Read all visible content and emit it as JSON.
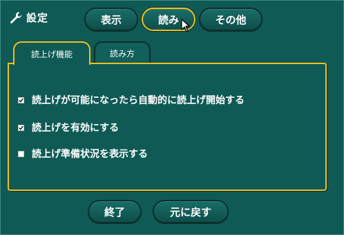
{
  "header": {
    "title": "設定"
  },
  "tabs": [
    {
      "label": "表示",
      "active": false
    },
    {
      "label": "読み",
      "active": true
    },
    {
      "label": "その他",
      "active": false
    }
  ],
  "subtabs": [
    {
      "label": "読上げ機能",
      "active": true
    },
    {
      "label": "読み方",
      "active": false
    }
  ],
  "options": [
    {
      "label": "読上げが可能になったら自動的に読上げ開始する",
      "checked": true
    },
    {
      "label": "読上げを有効にする",
      "checked": true
    },
    {
      "label": "読上げ準備状況を表示する",
      "checked": false
    }
  ],
  "footer": {
    "close_label": "終了",
    "revert_label": "元に戻す"
  },
  "colors": {
    "background": "#0f5a55",
    "accent": "#f0c020",
    "text": "#ffffff"
  },
  "icons": {
    "title_icon": "wrench-icon",
    "cursor": "mouse-pointer-icon"
  }
}
